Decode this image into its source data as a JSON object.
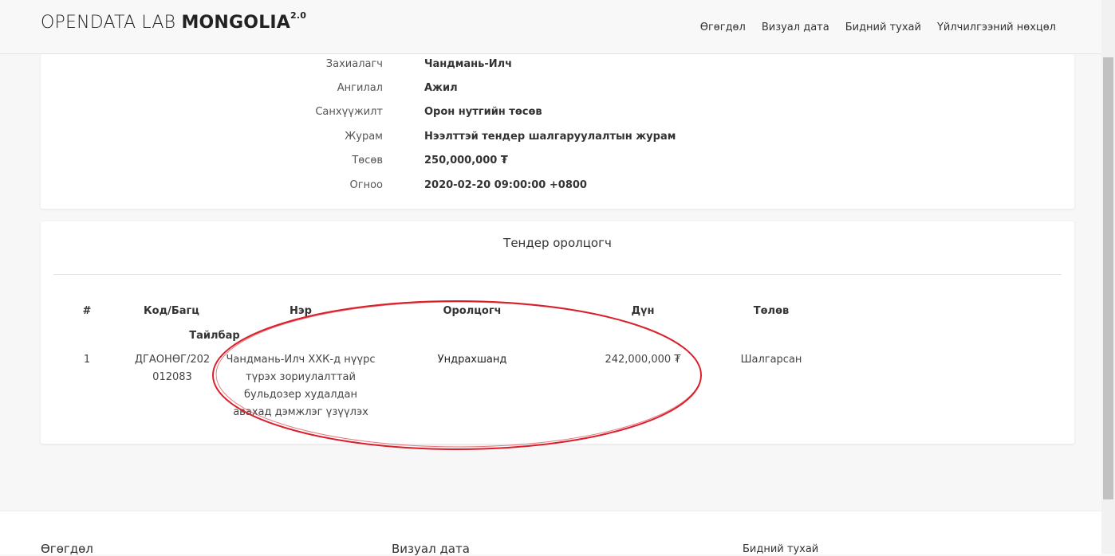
{
  "header": {
    "brand_light": "OPENDATA LAB",
    "brand_bold": "MONGOLIA",
    "brand_version": "2.0",
    "nav": [
      "Өгөгдөл",
      "Визуал дата",
      "Бидний тухай",
      "Үйлчилгээний нөхцөл"
    ]
  },
  "details": [
    {
      "label": "Захиалагч",
      "value": "Чандмань-Илч"
    },
    {
      "label": "Ангилал",
      "value": "Ажил"
    },
    {
      "label": "Санхүүжилт",
      "value": "Орон нутгийн төсөв"
    },
    {
      "label": "Журам",
      "value": "Нээлттэй тендер шалгаруулалтын журам"
    },
    {
      "label": "Төсөв",
      "value": "250,000,000 ₮"
    },
    {
      "label": "Огноо",
      "value": "2020-02-20 09:00:00 +0800"
    }
  ],
  "bidders": {
    "title": "Тендер оролцогч",
    "columns": [
      "#",
      "Код/Багц",
      "Нэр",
      "Оролцогч",
      "Дүн",
      "Төлөв",
      "Тайлбар"
    ],
    "rows": [
      {
        "num": "1",
        "code": "ДГАОНӨГ/202012083",
        "name": "Чандмань-Илч ХХК-д нүүрс түрэх зориулалттай бульдозер худалдан авахад дэмжлэг үзүүлэх",
        "bidder": "Ундрахшанд",
        "amount": "242,000,000 ₮",
        "status": "Шалгарсан"
      }
    ]
  },
  "footer": {
    "col1": "Өгөгдөл",
    "col2": "Визуал дата",
    "col3": "Бидний тухай"
  },
  "colors": {
    "annotation": "#d9202b",
    "card": "#ffffff",
    "background": "#f7f7f7"
  }
}
